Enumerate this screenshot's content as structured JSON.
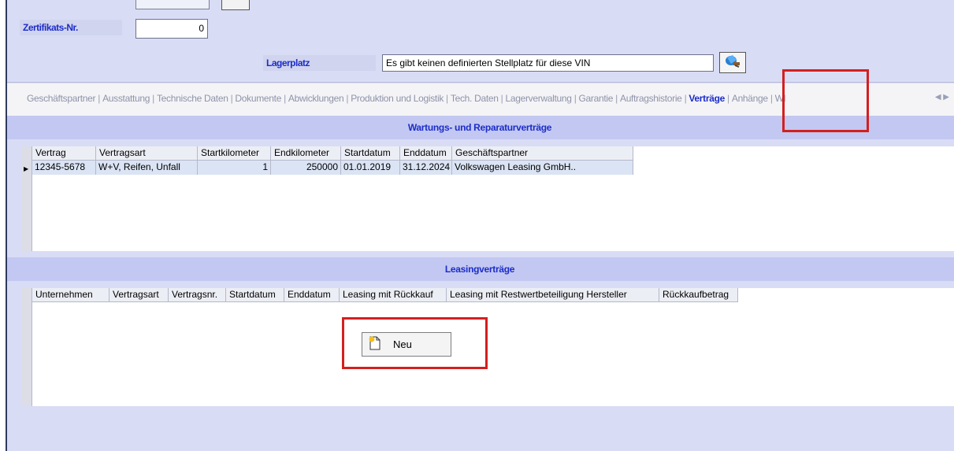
{
  "form": {
    "zertifikat_label": "Zertifikats-Nr.",
    "zertifikat_value": "0",
    "lagerplatz_label": "Lagerplatz",
    "lagerplatz_value": "Es gibt keinen definierten Stellplatz für diese VIN",
    "pick_icon": "vacuum-cleaner-icon"
  },
  "tabs": [
    {
      "label": "Geschäftspartner"
    },
    {
      "label": "Ausstattung"
    },
    {
      "label": "Technische Daten"
    },
    {
      "label": "Dokumente"
    },
    {
      "label": "Abwicklungen"
    },
    {
      "label": "Produktion und Logistik"
    },
    {
      "label": "Tech. Daten"
    },
    {
      "label": "Lagerverwaltung"
    },
    {
      "label": "Garantie"
    },
    {
      "label": "Auftragshistorie"
    },
    {
      "label": "Verträge",
      "active": true
    },
    {
      "label": "Anhänge"
    },
    {
      "label": "Wl"
    }
  ],
  "wartung": {
    "title": "Wartungs- und Reparaturverträge",
    "columns": [
      "Vertrag",
      "Vertragsart",
      "Startkilometer",
      "Endkilometer",
      "Startdatum",
      "Enddatum",
      "Geschäftspartner"
    ],
    "rows": [
      [
        "12345-5678",
        "W+V, Reifen, Unfall",
        "1",
        "250000",
        "01.01.2019",
        "31.12.2024",
        "Volkswagen Leasing GmbH.."
      ]
    ]
  },
  "leasing": {
    "title": "Leasingverträge",
    "columns": [
      "Unternehmen",
      "Vertragsart",
      "Vertragsnr.",
      "Startdatum",
      "Enddatum",
      "Leasing mit Rückkauf",
      "Leasing mit Restwertbeteiligung Hersteller",
      "Rückkaufbetrag"
    ],
    "new_button": "Neu"
  },
  "colors": {
    "accent_blue": "#1c2cc9",
    "highlight_red": "#d41f1f",
    "panel_bg": "#d9dcf5",
    "section_header_bg": "#c2c8f1"
  }
}
